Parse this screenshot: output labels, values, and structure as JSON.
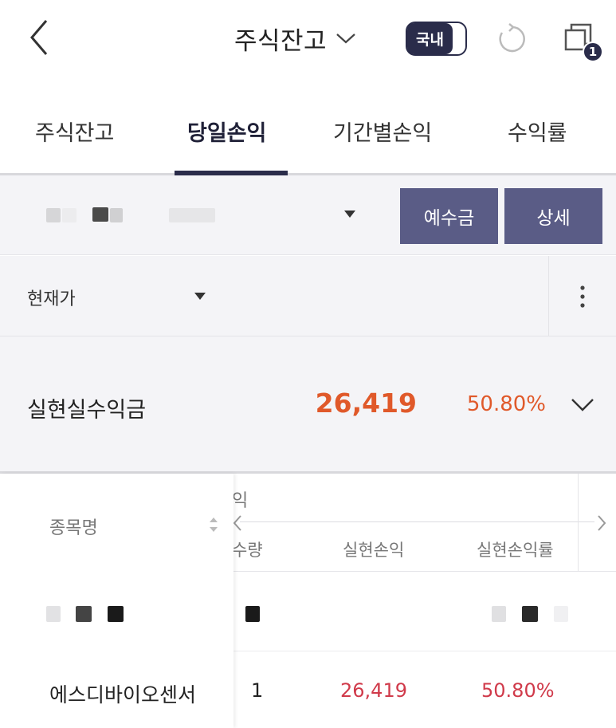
{
  "header": {
    "title": "주식잔고",
    "market_toggle": "국내",
    "notification_count": "1"
  },
  "tabs": [
    {
      "label": "주식잔고",
      "active": false
    },
    {
      "label": "당일손익",
      "active": true
    },
    {
      "label": "기간별손익",
      "active": false
    },
    {
      "label": "수익률",
      "active": false
    }
  ],
  "account": {
    "deposit_button": "예수금",
    "detail_button": "상세"
  },
  "price_filter": {
    "selected": "현재가"
  },
  "summary": {
    "label": "실현실수익금",
    "value": "26,419",
    "rate": "50.80%"
  },
  "table": {
    "name_header": "종목명",
    "group_label": "익",
    "columns": [
      "수량",
      "실현손익",
      "실현손익률"
    ],
    "rows": [
      {
        "name": "에스디바이오센서",
        "qty": "1",
        "profit": "26,419",
        "rate": "50.80%"
      }
    ]
  },
  "colors": {
    "accent_navy": "#2a2c4a",
    "button_purple": "#5a5c86",
    "profit_orange": "#e0592a",
    "profit_red": "#d03a4a"
  }
}
